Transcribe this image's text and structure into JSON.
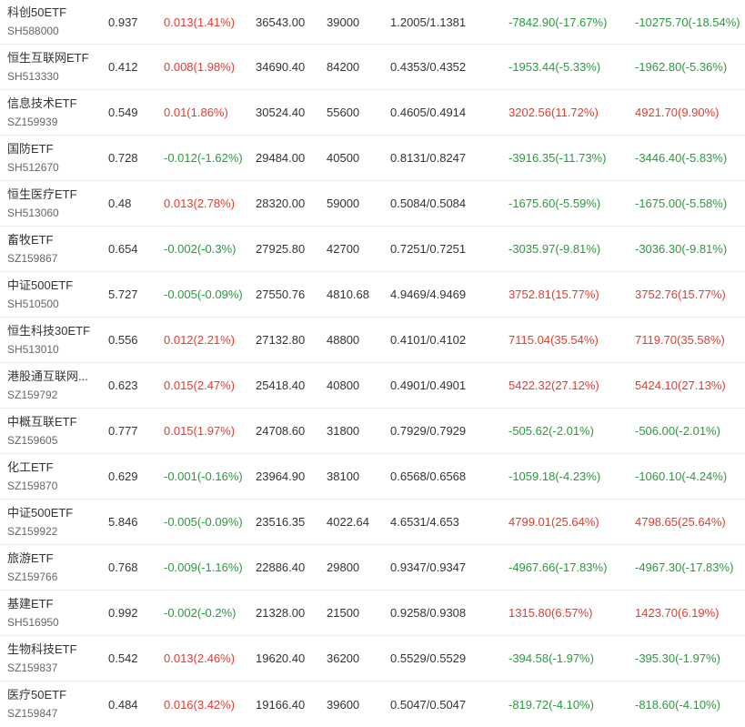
{
  "colors": {
    "up": "#e33b2e",
    "down": "#2a9a3d",
    "text": "#333333",
    "subtext": "#666666",
    "divider": "#ececec"
  },
  "rows": [
    {
      "name": "科创50ETF",
      "code": "SH588000",
      "price": "0.937",
      "change": "0.013(1.41%)",
      "change_dir": "up",
      "amount": "36543.00",
      "volume": "39000",
      "range": "1.2005/1.1381",
      "pl1": "-7842.90(-17.67%)",
      "pl1_dir": "down",
      "pl2": "-10275.70(-18.54%)",
      "pl2_dir": "down"
    },
    {
      "name": "恒生互联网ETF",
      "code": "SH513330",
      "price": "0.412",
      "change": "0.008(1.98%)",
      "change_dir": "up",
      "amount": "34690.40",
      "volume": "84200",
      "range": "0.4353/0.4352",
      "pl1": "-1953.44(-5.33%)",
      "pl1_dir": "down",
      "pl2": "-1962.80(-5.36%)",
      "pl2_dir": "down"
    },
    {
      "name": "信息技术ETF",
      "code": "SZ159939",
      "price": "0.549",
      "change": "0.01(1.86%)",
      "change_dir": "up",
      "amount": "30524.40",
      "volume": "55600",
      "range": "0.4605/0.4914",
      "pl1": "3202.56(11.72%)",
      "pl1_dir": "up",
      "pl2": "4921.70(9.90%)",
      "pl2_dir": "up"
    },
    {
      "name": "国防ETF",
      "code": "SH512670",
      "price": "0.728",
      "change": "-0.012(-1.62%)",
      "change_dir": "down",
      "amount": "29484.00",
      "volume": "40500",
      "range": "0.8131/0.8247",
      "pl1": "-3916.35(-11.73%)",
      "pl1_dir": "down",
      "pl2": "-3446.40(-5.83%)",
      "pl2_dir": "down"
    },
    {
      "name": "恒生医疗ETF",
      "code": "SH513060",
      "price": "0.48",
      "change": "0.013(2.78%)",
      "change_dir": "up",
      "amount": "28320.00",
      "volume": "59000",
      "range": "0.5084/0.5084",
      "pl1": "-1675.60(-5.59%)",
      "pl1_dir": "down",
      "pl2": "-1675.00(-5.58%)",
      "pl2_dir": "down"
    },
    {
      "name": "畜牧ETF",
      "code": "SZ159867",
      "price": "0.654",
      "change": "-0.002(-0.3%)",
      "change_dir": "down",
      "amount": "27925.80",
      "volume": "42700",
      "range": "0.7251/0.7251",
      "pl1": "-3035.97(-9.81%)",
      "pl1_dir": "down",
      "pl2": "-3036.30(-9.81%)",
      "pl2_dir": "down"
    },
    {
      "name": "中证500ETF",
      "code": "SH510500",
      "price": "5.727",
      "change": "-0.005(-0.09%)",
      "change_dir": "down",
      "amount": "27550.76",
      "volume": "4810.68",
      "range": "4.9469/4.9469",
      "pl1": "3752.81(15.77%)",
      "pl1_dir": "up",
      "pl2": "3752.76(15.77%)",
      "pl2_dir": "up"
    },
    {
      "name": "恒生科技30ETF",
      "code": "SH513010",
      "price": "0.556",
      "change": "0.012(2.21%)",
      "change_dir": "up",
      "amount": "27132.80",
      "volume": "48800",
      "range": "0.4101/0.4102",
      "pl1": "7115.04(35.54%)",
      "pl1_dir": "up",
      "pl2": "7119.70(35.58%)",
      "pl2_dir": "up"
    },
    {
      "name": "港股通互联网...",
      "code": "SZ159792",
      "price": "0.623",
      "change": "0.015(2.47%)",
      "change_dir": "up",
      "amount": "25418.40",
      "volume": "40800",
      "range": "0.4901/0.4901",
      "pl1": "5422.32(27.12%)",
      "pl1_dir": "up",
      "pl2": "5424.10(27.13%)",
      "pl2_dir": "up"
    },
    {
      "name": "中概互联ETF",
      "code": "SZ159605",
      "price": "0.777",
      "change": "0.015(1.97%)",
      "change_dir": "up",
      "amount": "24708.60",
      "volume": "31800",
      "range": "0.7929/0.7929",
      "pl1": "-505.62(-2.01%)",
      "pl1_dir": "down",
      "pl2": "-506.00(-2.01%)",
      "pl2_dir": "down"
    },
    {
      "name": "化工ETF",
      "code": "SZ159870",
      "price": "0.629",
      "change": "-0.001(-0.16%)",
      "change_dir": "down",
      "amount": "23964.90",
      "volume": "38100",
      "range": "0.6568/0.6568",
      "pl1": "-1059.18(-4.23%)",
      "pl1_dir": "down",
      "pl2": "-1060.10(-4.24%)",
      "pl2_dir": "down"
    },
    {
      "name": "中证500ETF",
      "code": "SZ159922",
      "price": "5.846",
      "change": "-0.005(-0.09%)",
      "change_dir": "down",
      "amount": "23516.35",
      "volume": "4022.64",
      "range": "4.6531/4.653",
      "pl1": "4799.01(25.64%)",
      "pl1_dir": "up",
      "pl2": "4798.65(25.64%)",
      "pl2_dir": "up"
    },
    {
      "name": "旅游ETF",
      "code": "SZ159766",
      "price": "0.768",
      "change": "-0.009(-1.16%)",
      "change_dir": "down",
      "amount": "22886.40",
      "volume": "29800",
      "range": "0.9347/0.9347",
      "pl1": "-4967.66(-17.83%)",
      "pl1_dir": "down",
      "pl2": "-4967.30(-17.83%)",
      "pl2_dir": "down"
    },
    {
      "name": "基建ETF",
      "code": "SH516950",
      "price": "0.992",
      "change": "-0.002(-0.2%)",
      "change_dir": "down",
      "amount": "21328.00",
      "volume": "21500",
      "range": "0.9258/0.9308",
      "pl1": "1315.80(6.57%)",
      "pl1_dir": "up",
      "pl2": "1423.70(6.19%)",
      "pl2_dir": "up"
    },
    {
      "name": "生物科技ETF",
      "code": "SZ159837",
      "price": "0.542",
      "change": "0.013(2.46%)",
      "change_dir": "up",
      "amount": "19620.40",
      "volume": "36200",
      "range": "0.5529/0.5529",
      "pl1": "-394.58(-1.97%)",
      "pl1_dir": "down",
      "pl2": "-395.30(-1.97%)",
      "pl2_dir": "down"
    },
    {
      "name": "医疗50ETF",
      "code": "SZ159847",
      "price": "0.484",
      "change": "0.016(3.42%)",
      "change_dir": "up",
      "amount": "19166.40",
      "volume": "39600",
      "range": "0.5047/0.5047",
      "pl1": "-819.72(-4.10%)",
      "pl1_dir": "down",
      "pl2": "-818.60(-4.10%)",
      "pl2_dir": "down"
    }
  ]
}
